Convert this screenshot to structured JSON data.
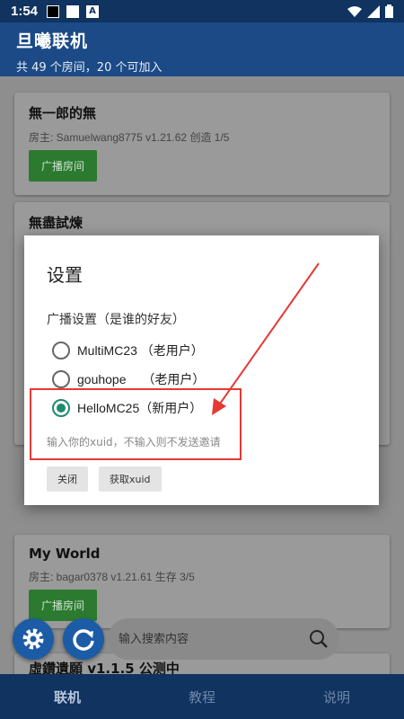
{
  "status": {
    "time": "1:54",
    "a_badge": "A"
  },
  "header": {
    "title": "旦曦联机",
    "subtitle": "共 49 个房间，20 个可加入"
  },
  "rooms": [
    {
      "name": "無一郎的無",
      "meta": "房主: Samuelwang8775 v1.21.62 创造 1/5",
      "button": "广播房间"
    },
    {
      "name": "無盡試煉"
    },
    {
      "name": "My World",
      "meta": "房主: bagar0378 v1.21.61 生存 3/5",
      "button": "广播房间"
    },
    {
      "name": "虛鑽遺願 v1.1.5 公测中"
    }
  ],
  "dialog": {
    "title": "设置",
    "label": "广播设置（是谁的好友）",
    "options": [
      {
        "label": "MultiMC23 （老用户）",
        "checked": false
      },
      {
        "label": "gouhope　 （老用户）",
        "checked": false
      },
      {
        "label": "HelloMC25（新用户）",
        "checked": true
      }
    ],
    "xuid_placeholder": "输入你的xuid，不输入则不发送邀请",
    "close_label": "关闭",
    "get_xuid_label": "获取xuid"
  },
  "search": {
    "placeholder": "输入搜索内容"
  },
  "nav": {
    "tabs": [
      "联机",
      "教程",
      "说明"
    ],
    "active": 0
  },
  "colors": {
    "header": "#1b4a86",
    "statusbar": "#10335f",
    "button_green": "#2b7a30",
    "radio_checked": "#1f8a70",
    "highlight": "#e53935"
  }
}
